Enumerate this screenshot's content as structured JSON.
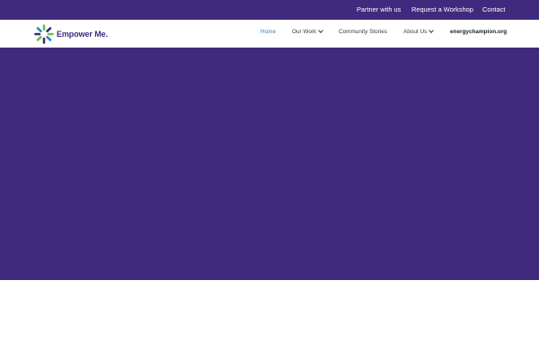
{
  "topbar": {
    "links": [
      "Partner with us",
      "Request a Workshop",
      "Contact"
    ]
  },
  "brand": {
    "name": "Empower Me.",
    "logo_icon": "sunburst-logo-icon",
    "colors": {
      "purple": "#3f2a7e",
      "green": "#6bbf4a",
      "blue": "#2a86c6"
    }
  },
  "nav": {
    "home": "Home",
    "our_work": "Our Work",
    "community_stories": "Community Stories",
    "about_us": "About Us",
    "site": "energychampion.org"
  },
  "hero": {
    "background": "#3f2a7e"
  }
}
